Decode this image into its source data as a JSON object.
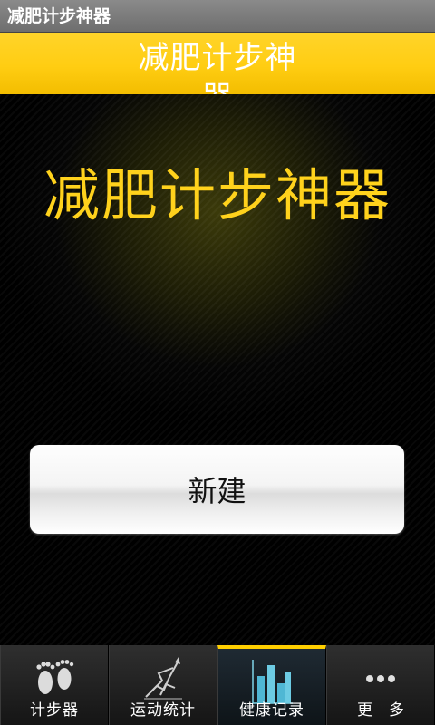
{
  "app": {
    "window_title": "减肥计步神器"
  },
  "header": {
    "title": "减肥计步神器"
  },
  "main": {
    "big_title": "减肥计步神器",
    "new_button_label": "新建"
  },
  "tabs": [
    {
      "label": "计步器",
      "icon": "footprints-icon",
      "active": false
    },
    {
      "label": "运动统计",
      "icon": "runner-icon",
      "active": false
    },
    {
      "label": "健康记录",
      "icon": "bar-chart-icon",
      "active": true
    },
    {
      "label": "更多",
      "icon": "more-dots-icon",
      "active": false
    }
  ],
  "colors": {
    "accent_yellow": "#ffd21c",
    "header_yellow": "#ffcd12",
    "background": "#000000",
    "active_tab_bar": "#ffcf00"
  }
}
